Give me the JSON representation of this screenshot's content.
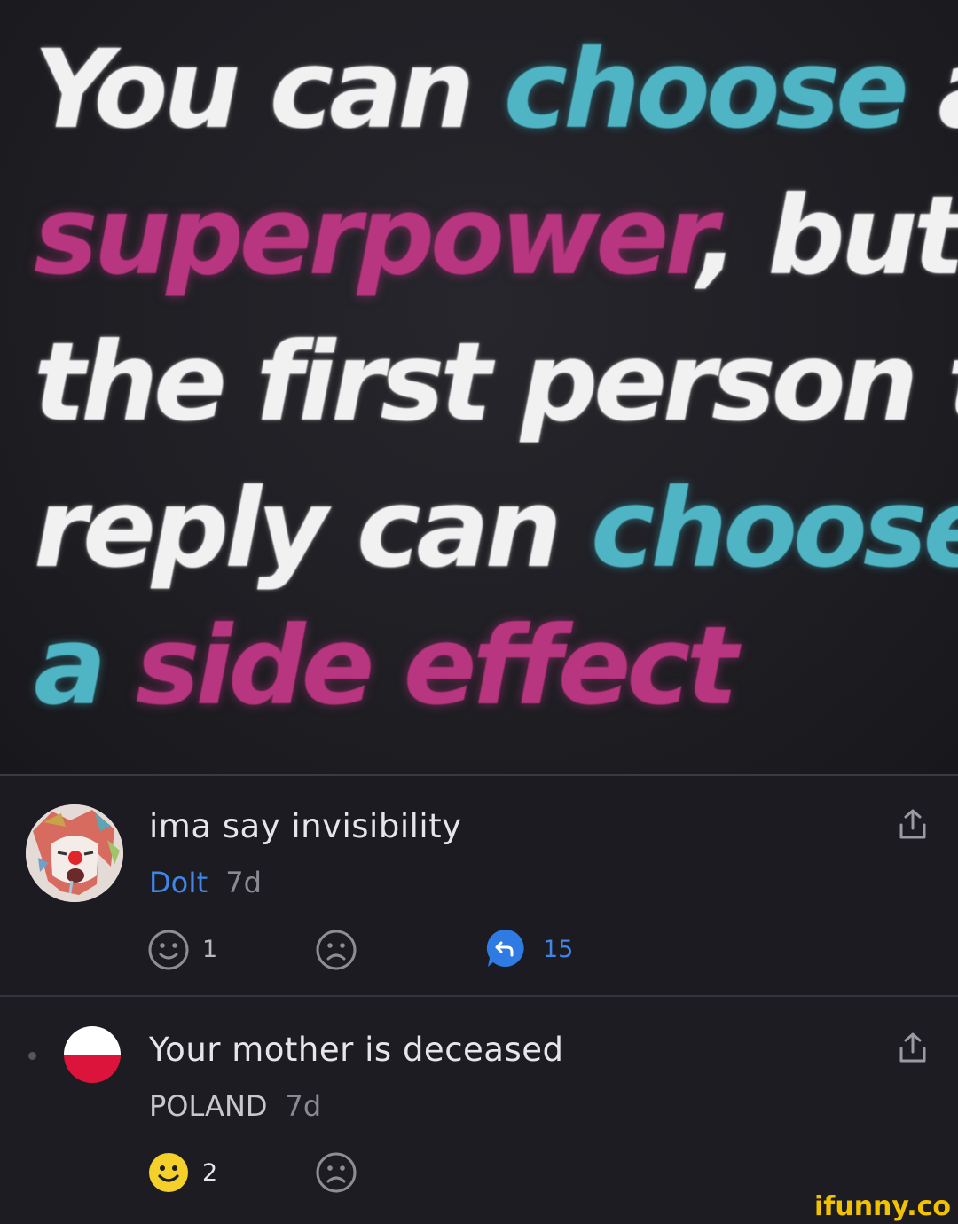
{
  "meme": {
    "line1": [
      "You can",
      "choose",
      "a"
    ],
    "line2": [
      "superpower",
      ", but"
    ],
    "line3": "the first person to",
    "line4": [
      "reply can",
      "choose"
    ],
    "line5": [
      "a",
      "side effect"
    ]
  },
  "comments": [
    {
      "text": "ima say invisibility",
      "author": "DoIt",
      "time": "7d",
      "smile_count": "1",
      "reply_count": "15"
    },
    {
      "text": "Your mother is deceased",
      "author": "POLAND",
      "time": "7d",
      "smile_count": "2"
    }
  ],
  "icons": {
    "share": "share-icon",
    "smile": "smile-icon",
    "frown": "frown-icon",
    "reply": "reply-bubble-icon"
  },
  "colors": {
    "teal": "#4fb4c3",
    "pink": "#b8357f",
    "author_blue": "#3f86e8",
    "reply_blue": "#2f7be4",
    "smile_yellow": "#f5cf2a"
  },
  "watermark": "ifunny.co"
}
